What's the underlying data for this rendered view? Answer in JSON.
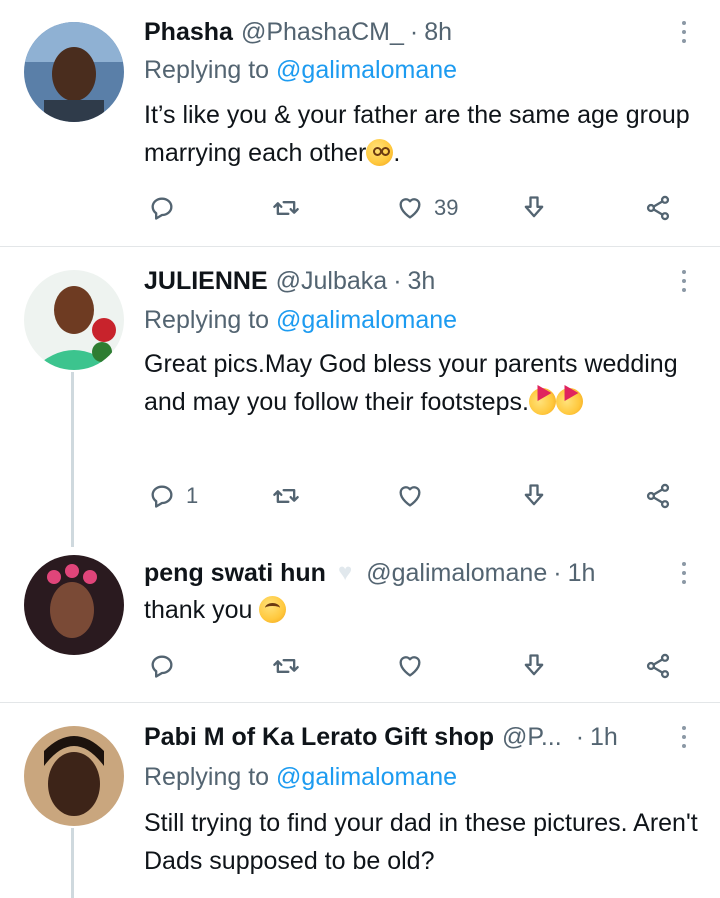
{
  "tweets": [
    {
      "name": "Phasha",
      "handle": "@PhashaCM_",
      "time": "8h",
      "replying_label": "Replying to",
      "replying_to": "@galimalomane",
      "text": "It’s like you & your father are the same age group marrying each other",
      "text_suffix": ".",
      "emoji": "flushed-face",
      "reply_count": "",
      "like_count": "39"
    },
    {
      "name": "JULIENNE",
      "handle": "@Julbaka",
      "time": "3h",
      "replying_label": "Replying to",
      "replying_to": "@galimalomane",
      "text": "Great pics.May God bless your parents wedding and may you  follow their footsteps.",
      "emoji": "partying-face",
      "reply_count": "1",
      "like_count": ""
    },
    {
      "name": "peng swati hun",
      "name_badge": "white-heart",
      "handle": "@galimalomane",
      "time": "1h",
      "text": "thank you ",
      "emoji": "face-with-rolling-eyes",
      "reply_count": "",
      "like_count": ""
    },
    {
      "name": "Pabi M of Ka Lerato Gift shop",
      "handle": "@P...",
      "time": "1h",
      "replying_label": "Replying to",
      "replying_to": "@galimalomane",
      "text": "Still trying to find your dad in these pictures. Aren't Dads supposed to be old?"
    }
  ],
  "icons": {
    "reply": "reply-icon",
    "retweet": "retweet-icon",
    "like": "heart-icon",
    "download": "download-icon",
    "share": "share-icon",
    "more": "more-icon"
  },
  "colors": {
    "link": "#1d9bf0",
    "secondary_text": "#536471",
    "divider": "#e3e6e8"
  }
}
